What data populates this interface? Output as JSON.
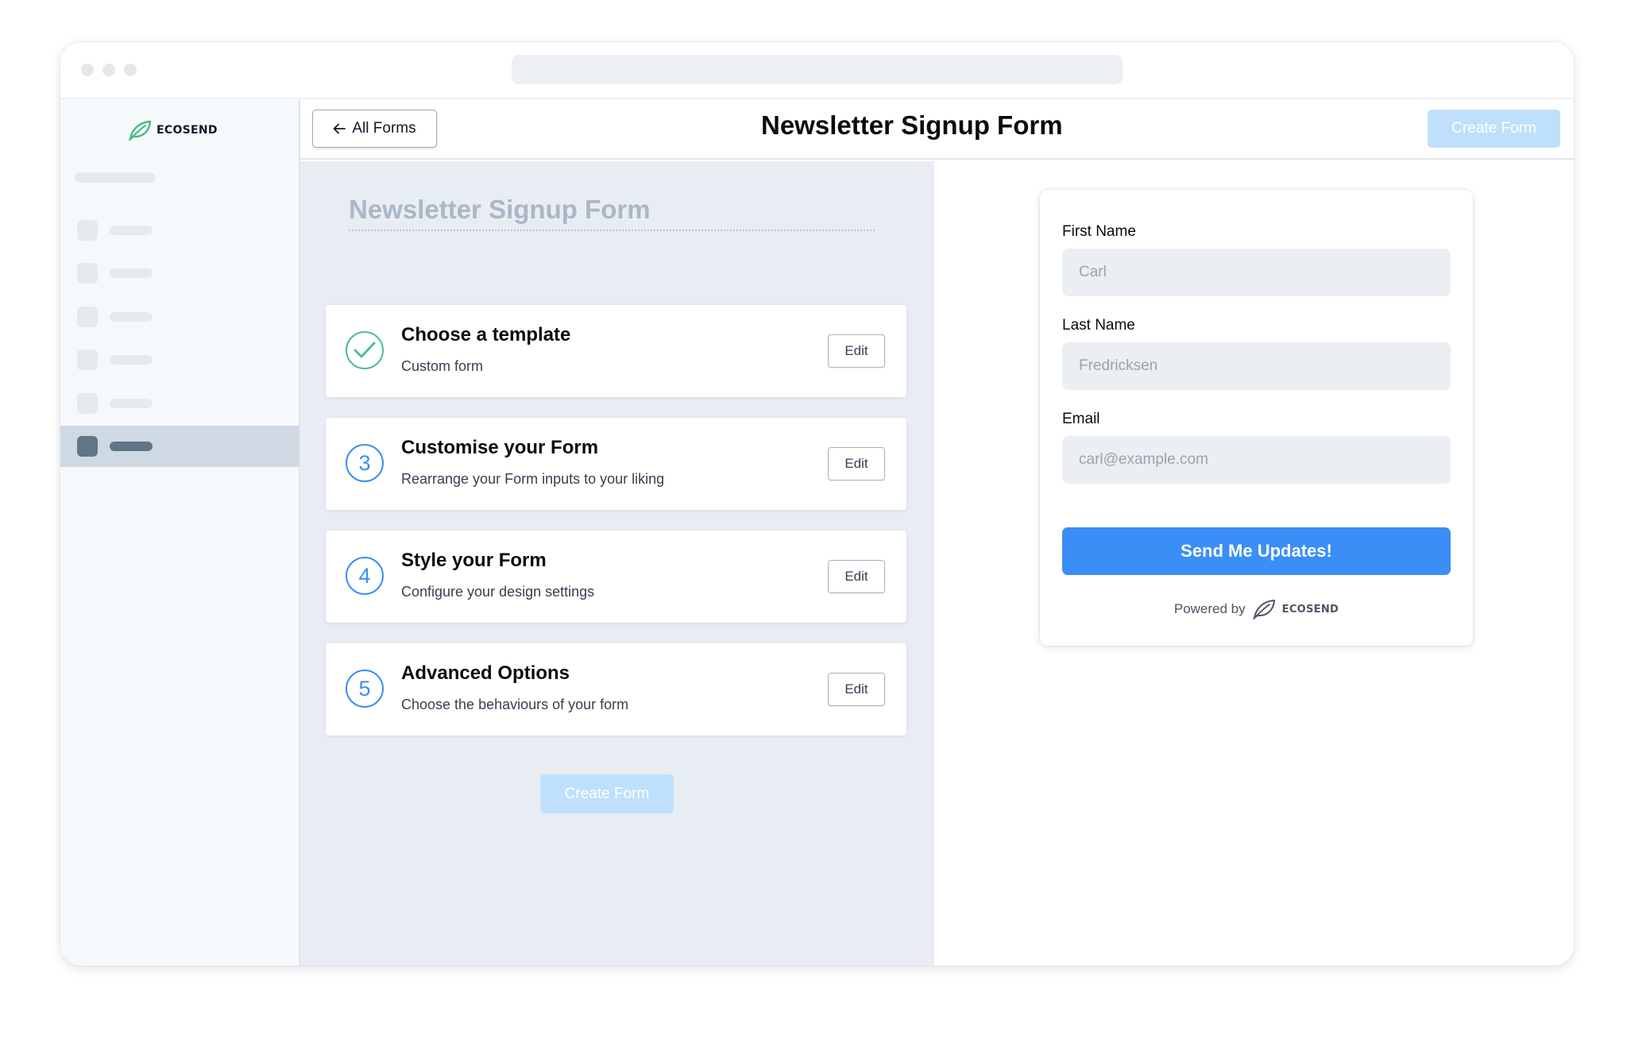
{
  "app": {
    "brand": "ECOSEND",
    "brand_icon": "leaf-icon",
    "accent_color": "#3b8ef5",
    "success_color": "#4cc08e"
  },
  "topbar": {
    "back_label": "All Forms",
    "back_icon": "arrow-left-icon",
    "title": "Newsletter Signup Form",
    "create_label": "Create Form"
  },
  "editor": {
    "form_name": "Newsletter Signup Form",
    "steps": [
      {
        "marker": "✓",
        "marker_icon": "check-circle-icon",
        "title": "Choose a template",
        "description": "Custom form",
        "edit_label": "Edit"
      },
      {
        "marker": "3",
        "title": "Customise your Form",
        "description": "Rearrange your Form inputs to your liking",
        "edit_label": "Edit"
      },
      {
        "marker": "4",
        "title": "Style your Form",
        "description": "Configure your design settings",
        "edit_label": "Edit"
      },
      {
        "marker": "5",
        "title": "Advanced Options",
        "description": "Choose the behaviours of your form",
        "edit_label": "Edit"
      }
    ],
    "create_label": "Create Form"
  },
  "preview": {
    "fields": [
      {
        "label": "First Name",
        "placeholder": "Carl"
      },
      {
        "label": "Last Name",
        "placeholder": "Fredricksen"
      },
      {
        "label": "Email",
        "placeholder": "carl@example.com"
      }
    ],
    "submit_label": "Send Me Updates!",
    "powered_by": "Powered by",
    "powered_brand": "ECOSEND"
  }
}
